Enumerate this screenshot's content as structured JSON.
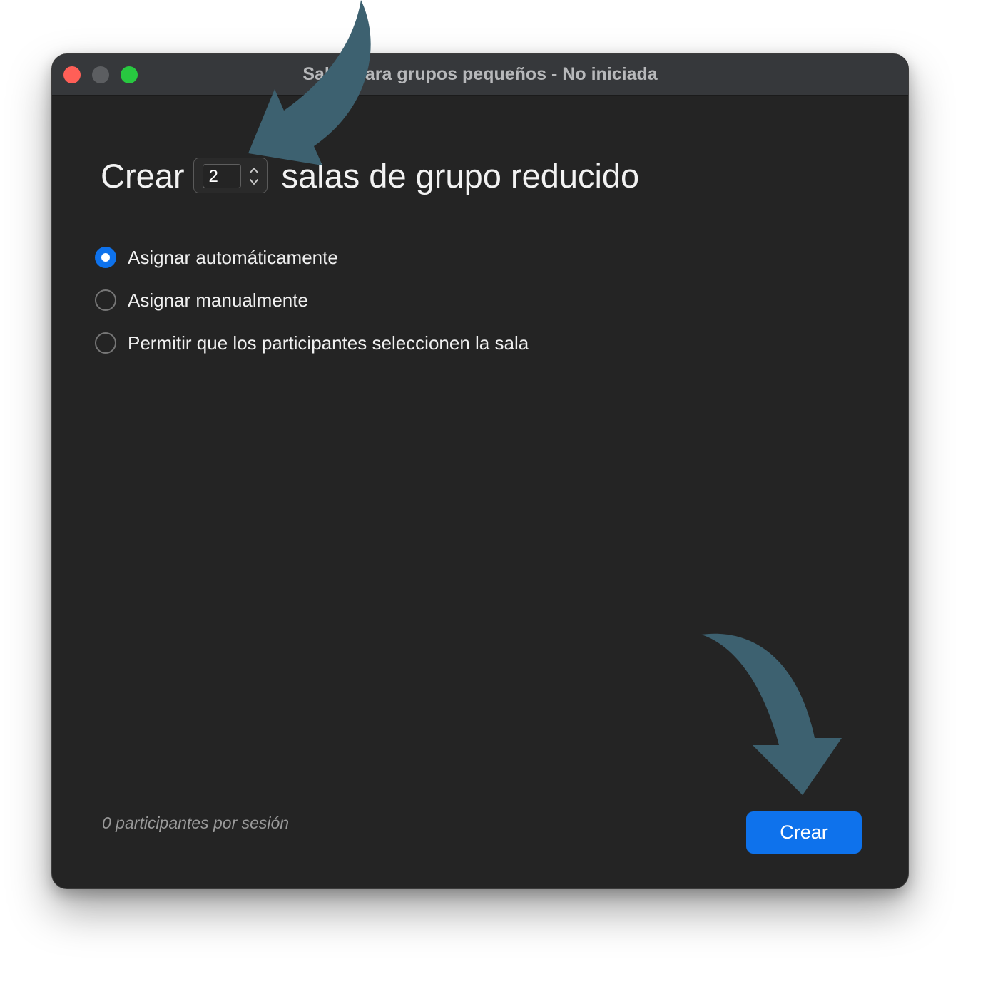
{
  "window": {
    "title": "Salas para grupos pequeños - No iniciada"
  },
  "heading": {
    "prefix": "Crear",
    "room_count": "2",
    "suffix": "salas de grupo reducido"
  },
  "options": [
    {
      "label": "Asignar automáticamente",
      "checked": true
    },
    {
      "label": "Asignar manualmente",
      "checked": false
    },
    {
      "label": "Permitir que los participantes seleccionen la sala",
      "checked": false
    }
  ],
  "footer": {
    "participants_text": "0 participantes por sesión",
    "create_label": "Crear"
  },
  "colors": {
    "window_bg": "#242424",
    "titlebar_bg": "#36383b",
    "accent": "#0e72ec",
    "annotation_arrow": "#3d6170"
  }
}
